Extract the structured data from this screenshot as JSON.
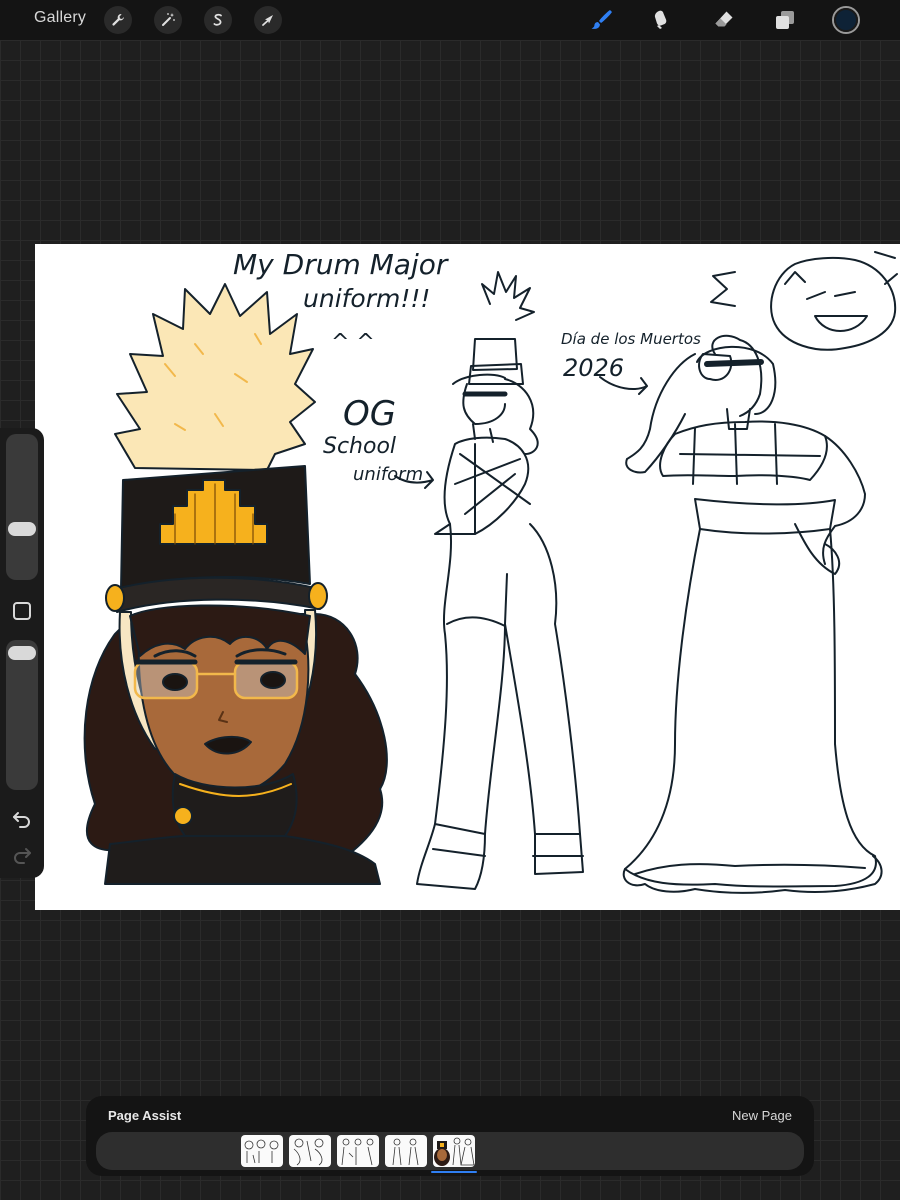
{
  "topbar": {
    "gallery_label": "Gallery",
    "left_tools": [
      "wrench-icon",
      "magic-wand-icon",
      "selection-s-icon",
      "transform-arrow-icon"
    ],
    "right_tools": [
      "brush-icon",
      "smudge-icon",
      "eraser-icon",
      "layers-icon"
    ],
    "active_tool": "brush-icon",
    "accent_color": "#2f7ff3",
    "current_color": "#0e2236"
  },
  "canvas": {
    "annotations": {
      "line1": "My Drum Major",
      "line2": "uniform!!!",
      "faces": "^ ^",
      "og": "OG",
      "school": "School",
      "school_uniform": "uniform",
      "dia": "Día de los Muertos",
      "year": "2026"
    }
  },
  "sidebar": {
    "tools": [
      "brush-size-slider",
      "modify-button",
      "opacity-slider",
      "undo-icon",
      "redo-icon"
    ]
  },
  "bottom_panel": {
    "title": "Page Assist",
    "new_page_label": "New Page",
    "pages_count": 5,
    "active_page_index": 5
  }
}
